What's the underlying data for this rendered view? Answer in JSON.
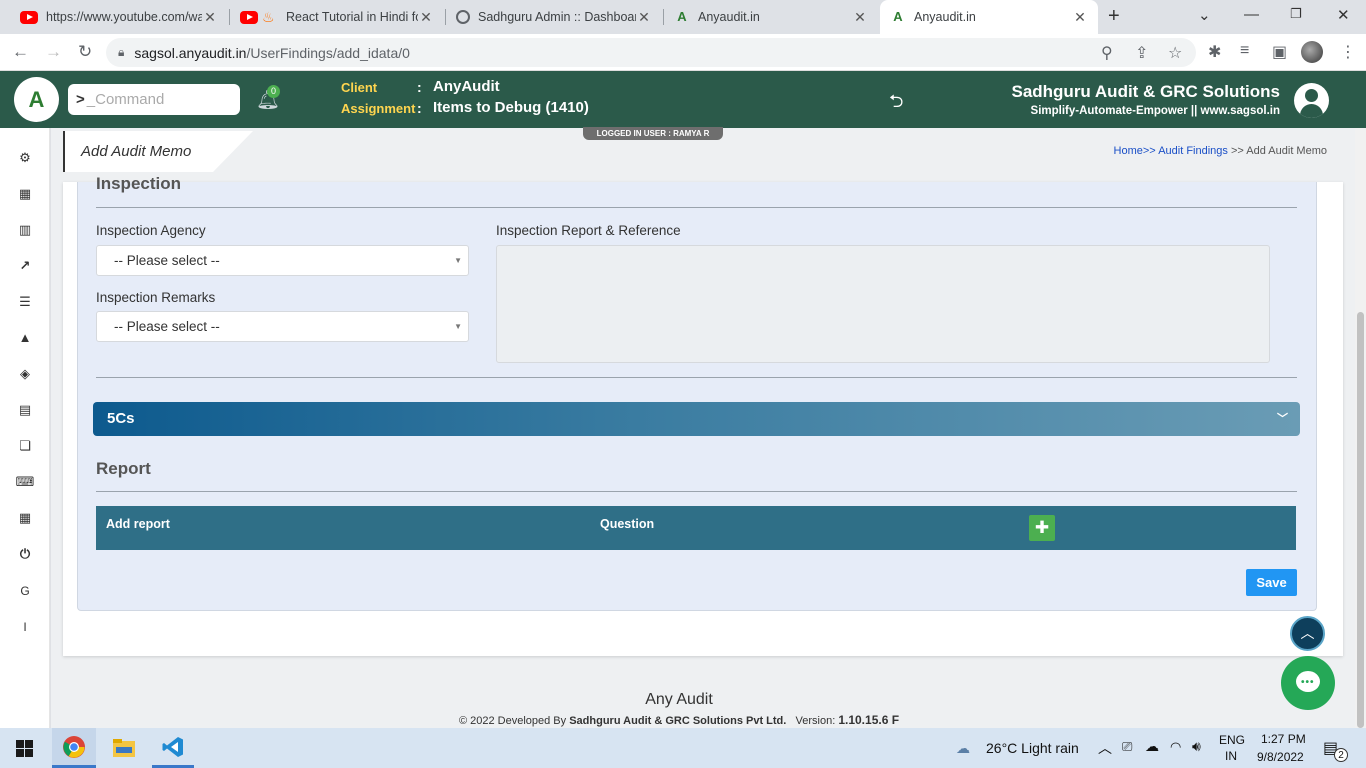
{
  "browser": {
    "tabs": [
      {
        "title": "https://www.youtube.com/wa",
        "favicon": "youtube-icon"
      },
      {
        "title": "React Tutorial in Hindi for",
        "favicon": "fire-icon"
      },
      {
        "title": "Sadhguru Admin :: Dashboar",
        "favicon": "globe-icon"
      },
      {
        "title": "Anyaudit.in",
        "favicon": "anyaudit-icon"
      },
      {
        "title": "Anyaudit.in",
        "favicon": "anyaudit-icon"
      }
    ],
    "url_host": "sagsol.anyaudit.in",
    "url_path": "/UserFindings/add_idata/0"
  },
  "header": {
    "command_placeholder": "_Command",
    "notification_count": "0",
    "client_label": "Client",
    "client_value": "AnyAudit",
    "assignment_label": "Assignment",
    "assignment_value": "Items to Debug (1410)",
    "company_name": "Sadhguru Audit & GRC Solutions",
    "company_tagline": "Simplify-Automate-Empower || www.sagsol.in",
    "logged_in": "LOGGED IN USER :   RAMYA R"
  },
  "sidebar": {
    "icons": [
      "cogs-icon",
      "grid-icon",
      "bar-chart-icon",
      "line-chart-icon",
      "list-icon",
      "warning-icon",
      "cube-icon",
      "file-icon",
      "copy-icon",
      "keyboard-icon",
      "table-icon",
      "power-icon",
      "g-icon",
      "i-icon"
    ],
    "letters": {
      "g": "G",
      "i": "I"
    }
  },
  "page": {
    "title": "Add Audit Memo",
    "breadcrumb": {
      "home": "Home>>",
      "findings": "Audit Findings",
      "sep": ">>",
      "current": "Add Audit Memo"
    }
  },
  "inspection": {
    "title": "Inspection",
    "agency_label": "Inspection Agency",
    "agency_value": "-- Please select --",
    "remarks_label": "Inspection Remarks",
    "remarks_value": "-- Please select --",
    "report_label": "Inspection Report & Reference"
  },
  "accordion": {
    "title": "5Cs"
  },
  "report": {
    "title": "Report",
    "col_add_report": "Add report",
    "col_question": "Question",
    "save_label": "Save"
  },
  "footer": {
    "app_name": "Any Audit",
    "copyright": "© 2022 Developed By",
    "company": "Sadhguru Audit & GRC Solutions Pvt Ltd.",
    "version_label": "Version:",
    "version": "1.10.15.6 F"
  },
  "taskbar": {
    "weather": "26°C  Light rain",
    "lang_top": "ENG",
    "lang_bottom": "IN",
    "time": "1:27 PM",
    "date": "9/8/2022",
    "notif_count": "2"
  },
  "colors": {
    "header_bg": "#2b5a4a",
    "accent_yellow": "#ffd54f",
    "save_blue": "#2196f3",
    "add_green": "#4caf50",
    "table_header": "#2f6f87"
  }
}
